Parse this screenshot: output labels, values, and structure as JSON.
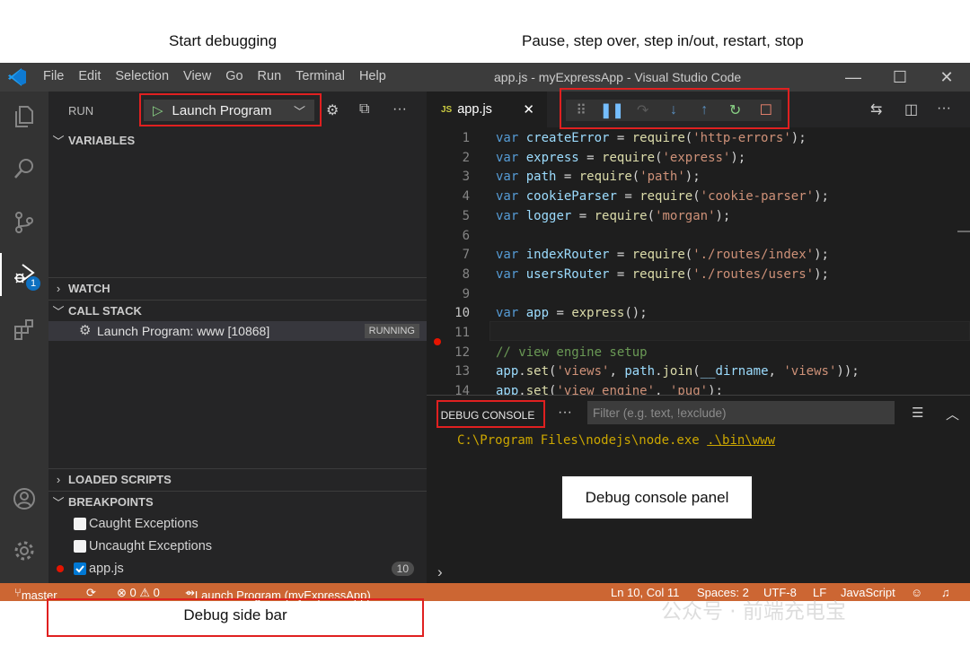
{
  "annotations": {
    "start_debugging": "Start debugging",
    "debug_controls": "Pause, step over, step in/out, restart, stop",
    "debug_console_panel": "Debug console panel",
    "debug_side_bar": "Debug side bar"
  },
  "titlebar": {
    "menu": [
      "File",
      "Edit",
      "Selection",
      "View",
      "Go",
      "Run",
      "Terminal",
      "Help"
    ],
    "title": "app.js - myExpressApp - Visual Studio Code",
    "minimize": "—",
    "maximize": "☐",
    "close": "✕"
  },
  "activity_bar": {
    "icons": [
      "explorer-icon",
      "search-icon",
      "source-control-icon",
      "run-debug-icon",
      "extensions-icon",
      "account-icon",
      "manage-icon"
    ],
    "debug_badge": "1"
  },
  "sidebar": {
    "header": "RUN",
    "launch_config": "Launch Program",
    "sections": {
      "variables": "VARIABLES",
      "watch": "WATCH",
      "call_stack": "CALL STACK",
      "loaded_scripts": "LOADED SCRIPTS",
      "breakpoints": "BREAKPOINTS"
    },
    "call_stack_item": "Launch Program: www [10868]",
    "call_stack_status": "RUNNING",
    "breakpoints": [
      {
        "label": "Caught Exceptions",
        "checked": false
      },
      {
        "label": "Uncaught Exceptions",
        "checked": false
      },
      {
        "label": "app.js",
        "checked": true,
        "count": "10"
      }
    ]
  },
  "editor": {
    "tab_badge": "JS",
    "tab_name": "app.js",
    "tab_close": "✕",
    "line_numbers": [
      "1",
      "2",
      "3",
      "4",
      "5",
      "6",
      "7",
      "8",
      "9",
      "10",
      "11",
      "12",
      "13",
      "14"
    ],
    "breakpoint_line": "10",
    "lines": [
      [
        [
          "kw",
          "var"
        ],
        [
          "p",
          " "
        ],
        [
          "vr",
          "createError"
        ],
        [
          "p",
          " = "
        ],
        [
          "fn",
          "require"
        ],
        [
          "p",
          "("
        ],
        [
          "st",
          "'http-errors'"
        ],
        [
          "p",
          ");"
        ]
      ],
      [
        [
          "kw",
          "var"
        ],
        [
          "p",
          " "
        ],
        [
          "vr",
          "express"
        ],
        [
          "p",
          " = "
        ],
        [
          "fn",
          "require"
        ],
        [
          "p",
          "("
        ],
        [
          "st",
          "'express'"
        ],
        [
          "p",
          ");"
        ]
      ],
      [
        [
          "kw",
          "var"
        ],
        [
          "p",
          " "
        ],
        [
          "vr",
          "path"
        ],
        [
          "p",
          " = "
        ],
        [
          "fn",
          "require"
        ],
        [
          "p",
          "("
        ],
        [
          "st",
          "'path'"
        ],
        [
          "p",
          ");"
        ]
      ],
      [
        [
          "kw",
          "var"
        ],
        [
          "p",
          " "
        ],
        [
          "vr",
          "cookieParser"
        ],
        [
          "p",
          " = "
        ],
        [
          "fn",
          "require"
        ],
        [
          "p",
          "("
        ],
        [
          "st",
          "'cookie-parser'"
        ],
        [
          "p",
          ");"
        ]
      ],
      [
        [
          "kw",
          "var"
        ],
        [
          "p",
          " "
        ],
        [
          "vr",
          "logger"
        ],
        [
          "p",
          " = "
        ],
        [
          "fn",
          "require"
        ],
        [
          "p",
          "("
        ],
        [
          "st",
          "'morgan'"
        ],
        [
          "p",
          ");"
        ]
      ],
      [],
      [
        [
          "kw",
          "var"
        ],
        [
          "p",
          " "
        ],
        [
          "vr",
          "indexRouter"
        ],
        [
          "p",
          " = "
        ],
        [
          "fn",
          "require"
        ],
        [
          "p",
          "("
        ],
        [
          "st",
          "'./routes/index'"
        ],
        [
          "p",
          ");"
        ]
      ],
      [
        [
          "kw",
          "var"
        ],
        [
          "p",
          " "
        ],
        [
          "vr",
          "usersRouter"
        ],
        [
          "p",
          " = "
        ],
        [
          "fn",
          "require"
        ],
        [
          "p",
          "("
        ],
        [
          "st",
          "'./routes/users'"
        ],
        [
          "p",
          ");"
        ]
      ],
      [],
      [
        [
          "kw",
          "var"
        ],
        [
          "p",
          " "
        ],
        [
          "vr",
          "app"
        ],
        [
          "p",
          " = "
        ],
        [
          "fn",
          "express"
        ],
        [
          "p",
          "();"
        ]
      ],
      [],
      [
        [
          "cm",
          "// view engine setup"
        ]
      ],
      [
        [
          "vr",
          "app"
        ],
        [
          "p",
          "."
        ],
        [
          "fn",
          "set"
        ],
        [
          "p",
          "("
        ],
        [
          "st",
          "'views'"
        ],
        [
          "p",
          ", "
        ],
        [
          "vr",
          "path"
        ],
        [
          "p",
          "."
        ],
        [
          "fn",
          "join"
        ],
        [
          "p",
          "("
        ],
        [
          "vr",
          "__dirname"
        ],
        [
          "p",
          ", "
        ],
        [
          "st",
          "'views'"
        ],
        [
          "p",
          "));"
        ]
      ],
      [
        [
          "vr",
          "app"
        ],
        [
          "p",
          "."
        ],
        [
          "fn",
          "set"
        ],
        [
          "p",
          "("
        ],
        [
          "st",
          "'view engine'"
        ],
        [
          "p",
          ", "
        ],
        [
          "st",
          "'pug'"
        ],
        [
          "p",
          ");"
        ]
      ]
    ]
  },
  "panel": {
    "tab": "DEBUG CONSOLE",
    "more": "···",
    "filter_placeholder": "Filter (e.g. text, !exclude)",
    "output_prefix": "C:\\Program Files\\nodejs\\node.exe ",
    "output_link": ".\\bin\\www",
    "prompt": "›"
  },
  "statusbar": {
    "branch": "master",
    "sync": "⟳",
    "problems": "⊗ 0 ⚠ 0",
    "debug_target": "Launch Program (myExpressApp)",
    "position": "Ln 10, Col 11",
    "spaces": "Spaces: 2",
    "encoding": "UTF-8",
    "eol": "LF",
    "language": "JavaScript"
  },
  "watermark": "公众号 · 前端充电宝",
  "colors": {
    "statusbar": "#cc6633",
    "accent_red": "#e02020",
    "breakpoint": "#e51400",
    "play_green": "#89d185",
    "pause_blue": "#75beff",
    "restart_green": "#89d185",
    "stop_orange": "#f48771"
  }
}
